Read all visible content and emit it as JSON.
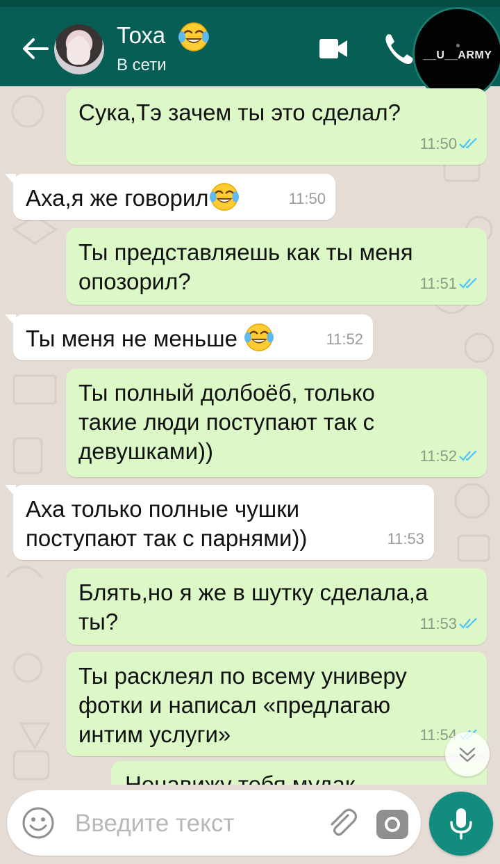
{
  "header": {
    "contact_name": "Тоха",
    "contact_status": "В сети",
    "watermark": "__U__ARMY"
  },
  "messages": [
    {
      "dir": "out",
      "text": "Сука,Тэ зачем ты это сделал?",
      "time": "11:50",
      "status": "read"
    },
    {
      "dir": "in",
      "text": "Аха,я же говорил",
      "time": "11:50",
      "emoji": "face-with-tears-of-joy"
    },
    {
      "dir": "out",
      "lines": [
        "Ты представляешь как ты меня",
        "опозорил?"
      ],
      "time": "11:51",
      "status": "read"
    },
    {
      "dir": "in",
      "text": "Ты меня не меньше",
      "time": "11:52",
      "emoji": "face-with-tears-of-joy"
    },
    {
      "dir": "out",
      "lines": [
        "Ты полный долбоёб, только",
        "такие люди поступают так с",
        "девушками))"
      ],
      "time": "11:52",
      "status": "read"
    },
    {
      "dir": "in",
      "lines": [
        "Аха только полные чушки",
        "поступают так с парнями))"
      ],
      "time": "11:53"
    },
    {
      "dir": "out",
      "lines": [
        "Блять,но я же в шутку сделала,а",
        "ты?"
      ],
      "time": "11:53",
      "status": "read"
    },
    {
      "dir": "out",
      "lines": [
        "Ты расклеял по всему универу",
        "фотки и написал «предлагаю",
        "интим услуги»"
      ],
      "time": "11:54",
      "status": "read"
    },
    {
      "dir": "out",
      "text": "Ненавижу тебя мудак",
      "partial": true
    }
  ],
  "composer": {
    "placeholder": "Введите текст"
  },
  "colors": {
    "header": "#075e54",
    "outgoing_bubble": "#dcf8c6",
    "incoming_bubble": "#ffffff",
    "read_ticks": "#4fc3f7",
    "mic_button": "#128c7e",
    "chat_background": "#e5ddd5"
  },
  "icons": [
    "back-arrow-icon",
    "video-call-icon",
    "phone-icon",
    "emoji-icon",
    "attach-icon",
    "camera-icon",
    "mic-icon",
    "scroll-down-icon"
  ]
}
